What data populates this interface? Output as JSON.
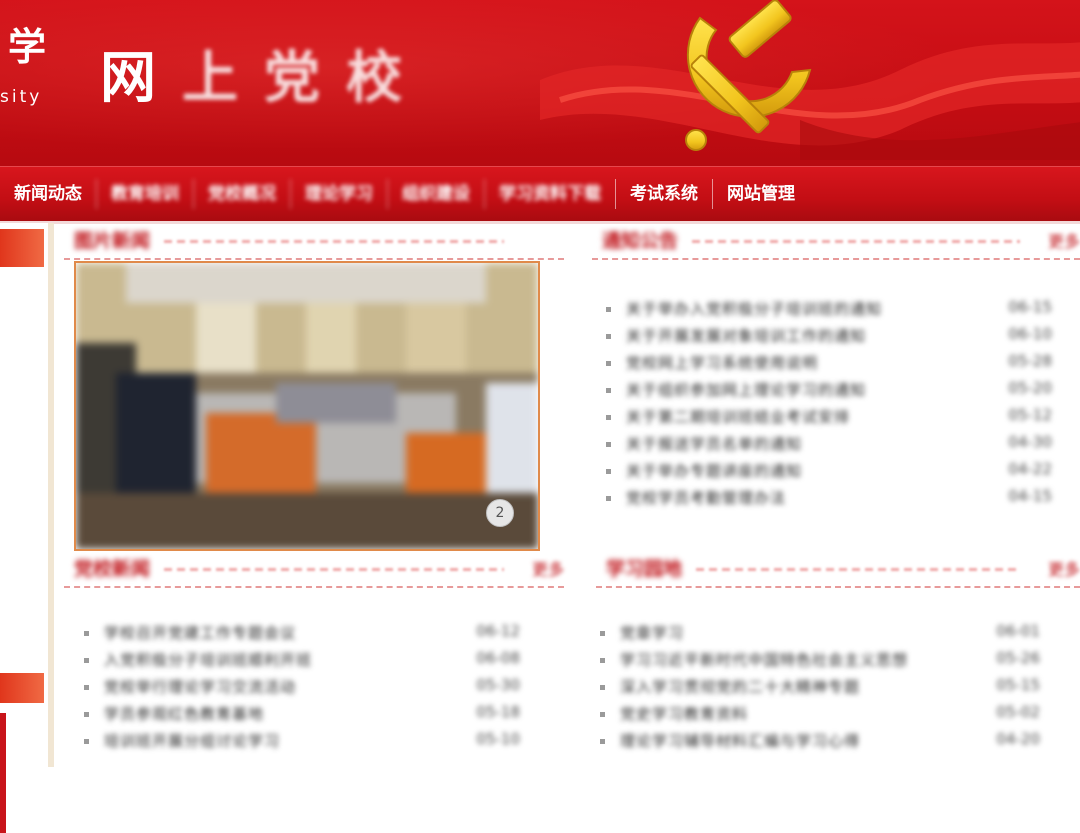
{
  "banner": {
    "university_char": "学",
    "university_en": "sity",
    "site_title_first": "网",
    "site_title_rest": "上党校",
    "colors": {
      "banner_red": "#c50d13",
      "emblem_gold": "#f2c51e"
    }
  },
  "nav": {
    "items": [
      {
        "label": "新闻动态",
        "blurred": false
      },
      {
        "label": "教育培训",
        "blurred": true
      },
      {
        "label": "党校概况",
        "blurred": true
      },
      {
        "label": "理论学习",
        "blurred": true
      },
      {
        "label": "组织建设",
        "blurred": true
      },
      {
        "label": "学习资料下载",
        "blurred": true
      },
      {
        "label": "考试系统",
        "blurred": false
      },
      {
        "label": "网站管理",
        "blurred": false
      }
    ]
  },
  "sections": {
    "photo_news": {
      "title": "图片新闻",
      "slide_indicator": "2"
    },
    "notices": {
      "title": "通知公告",
      "more": "更多",
      "items": [
        {
          "title": "关于举办入党积极分子培训班的通知",
          "date": "06-15"
        },
        {
          "title": "关于开展发展对象培训工作的通知",
          "date": "06-10"
        },
        {
          "title": "党校网上学习系统使用说明",
          "date": "05-28"
        },
        {
          "title": "关于组织参加网上理论学习的通知",
          "date": "05-20"
        },
        {
          "title": "关于第二期培训班结业考试安排",
          "date": "05-12"
        },
        {
          "title": "关于报送学员名单的通知",
          "date": "04-30"
        },
        {
          "title": "关于举办专题讲座的通知",
          "date": "04-22"
        },
        {
          "title": "党校学员考勤管理办法",
          "date": "04-15"
        }
      ]
    },
    "news": {
      "title": "党校新闻",
      "more": "更多",
      "items": [
        {
          "title": "学校召开党建工作专题会议",
          "date": "06-12"
        },
        {
          "title": "入党积极分子培训班顺利开班",
          "date": "06-08"
        },
        {
          "title": "党校举行理论学习交流活动",
          "date": "05-30"
        },
        {
          "title": "学员参观红色教育基地",
          "date": "05-18"
        },
        {
          "title": "培训班开展分组讨论学习",
          "date": "05-10"
        }
      ]
    },
    "study": {
      "title": "学习园地",
      "more": "更多",
      "items": [
        {
          "title": "党章学习",
          "date": "06-01"
        },
        {
          "title": "学习习近平新时代中国特色社会主义思想",
          "date": "05-26"
        },
        {
          "title": "深入学习贯彻党的二十大精神专题",
          "date": "05-15"
        },
        {
          "title": "党史学习教育资料",
          "date": "05-02"
        },
        {
          "title": "理论学习辅导材料汇编与学习心得",
          "date": "04-20"
        }
      ]
    }
  }
}
